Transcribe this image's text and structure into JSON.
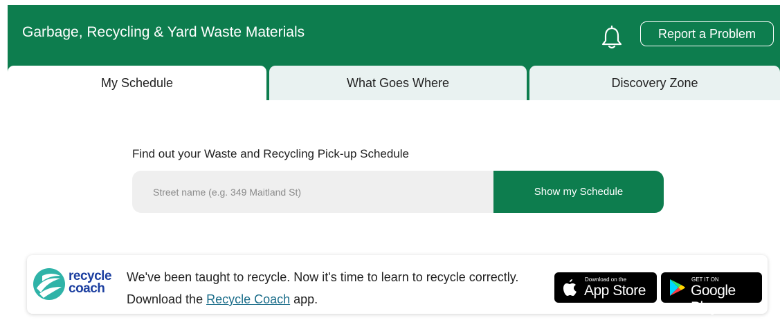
{
  "header": {
    "title": "Garbage, Recycling & Yard Waste Materials",
    "report_button": "Report a Problem",
    "bell_icon": "bell-icon"
  },
  "tabs": [
    {
      "label": "My Schedule",
      "active": true
    },
    {
      "label": "What Goes Where",
      "active": false
    },
    {
      "label": "Discovery Zone",
      "active": false
    }
  ],
  "schedule": {
    "prompt": "Find out your Waste and Recycling Pick-up Schedule",
    "placeholder": "Street name (e.g. 349 Maitland St)",
    "button": "Show my Schedule"
  },
  "promo": {
    "logo_line1": "recycle",
    "logo_line2": "coach",
    "text_before": "We've been taught to recycle. Now it's time to learn to recycle correctly. Download the ",
    "link": "Recycle Coach",
    "text_after": " app.",
    "app_store_small": "Download on the",
    "app_store_big": "App Store",
    "google_small": "GET IT ON",
    "google_big": "Google Play"
  },
  "colors": {
    "brand_green": "#0d7d4e",
    "tab_inactive": "#e9f2f1",
    "logo_blue": "#1c3fa0",
    "logo_teal": "#2fb3a8"
  }
}
